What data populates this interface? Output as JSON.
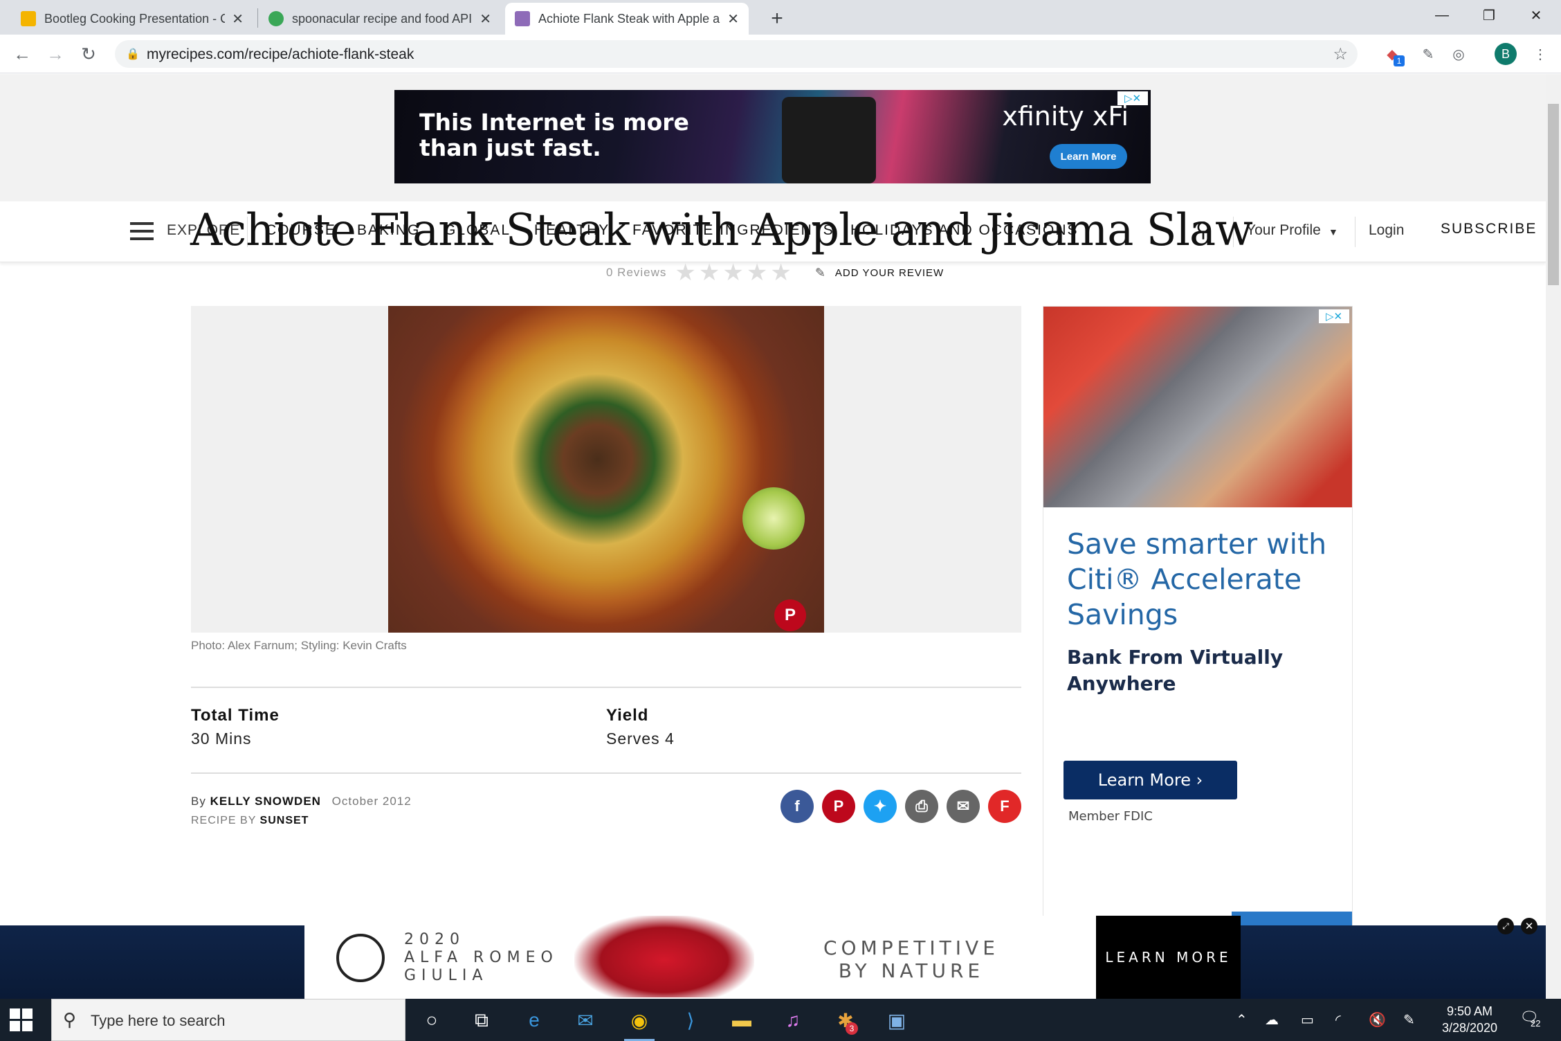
{
  "browser": {
    "tabs": [
      {
        "title": "Bootleg Cooking Presentation - C",
        "favicon_color": "#f4b400"
      },
      {
        "title": "spoonacular recipe and food API",
        "favicon_color": "#3aa757"
      },
      {
        "title": "Achiote Flank Steak with Apple a",
        "favicon_color": "#8e6bb8"
      }
    ],
    "new_tab": "+",
    "url": "myrecipes.com/recipe/achiote-flank-steak",
    "avatar_letter": "B",
    "ext_badge": "1"
  },
  "top_ad": {
    "headline_line1": "This Internet is more",
    "headline_line2": "than just fast.",
    "brand": "xfinity xFi",
    "cta": "Learn More"
  },
  "nav": {
    "explore": "EXPLORE",
    "items": [
      "COURSE",
      "BAKING",
      "GLOBAL",
      "HEALTHY",
      "FAVORITE INGREDIENTS",
      "HOLIDAYS AND OCCASIONS"
    ],
    "profile": "Your Profile",
    "login": "Login",
    "subscribe": "SUBSCRIBE"
  },
  "recipe": {
    "title": "Achiote Flank Steak with Apple and Jicama Slaw",
    "reviews": "0 Reviews",
    "stars": "★★★★★",
    "rating": 0,
    "add_review": "ADD YOUR REVIEW",
    "photo_credit": "Photo: Alex Farnum; Styling: Kevin Crafts",
    "total_time_label": "Total Time",
    "total_time": "30 Mins",
    "yield_label": "Yield",
    "yield": "Serves 4",
    "by": "By",
    "author": "KELLY SNOWDEN",
    "date": "October 2012",
    "recipe_by_label": "RECIPE BY",
    "recipe_by": "SUNSET"
  },
  "share_icons": [
    "facebook-icon",
    "pinterest-icon",
    "twitter-icon",
    "print-icon",
    "email-icon",
    "flipboard-icon"
  ],
  "side_ad": {
    "line1": "Save smarter with",
    "line2": "Citi® Accelerate",
    "line3": "Savings",
    "sub1": "Bank From Virtually",
    "sub2": "Anywhere",
    "cta": "Learn More  ›",
    "footer": "Member FDIC"
  },
  "bottom_ad": {
    "model_line1": "2020",
    "model_line2": "ALFA ROMEO",
    "model_line3": "GIULIA",
    "tag_line1": "COMPETITIVE",
    "tag_line2": "BY NATURE",
    "cta": "LEARN MORE"
  },
  "taskbar": {
    "search_placeholder": "Type here to search",
    "time": "9:50 AM",
    "date": "3/28/2020",
    "notifications": "22",
    "slack_badge": "3"
  }
}
